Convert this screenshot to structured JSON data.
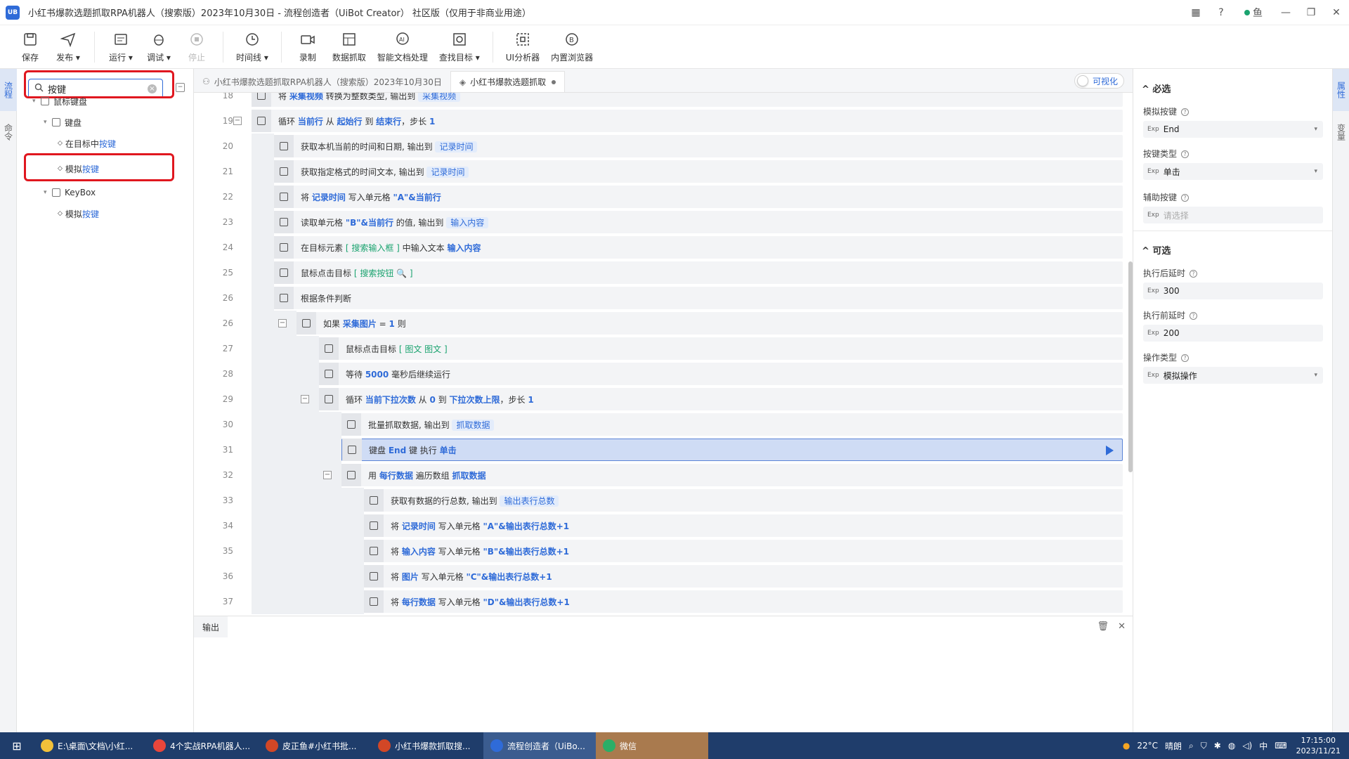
{
  "window": {
    "title": "小红书爆款选题抓取RPA机器人（搜索版）2023年10月30日 - 流程创造者（UiBot Creator） 社区版（仅用于非商业用途）",
    "logo_text": "UB",
    "user": "鱼"
  },
  "toolbar": {
    "save": "保存",
    "publish": "发布",
    "run": "运行",
    "debug": "调试",
    "stop": "停止",
    "timeline": "时间线",
    "record": "录制",
    "data_scrape": "数据抓取",
    "smart_doc": "智能文档处理",
    "find_target": "查找目标",
    "ui_analyzer": "UI分析器",
    "browser": "内置浏览器"
  },
  "left_rail": {
    "tab1": "流程",
    "tab2": "命令"
  },
  "left_panel": {
    "search_value": "按键",
    "tree": [
      {
        "label": "鼠标键盘"
      },
      {
        "label": "键盘"
      },
      {
        "prefix": "在目标中",
        "match": "按键"
      },
      {
        "prefix": "模拟",
        "match": "按键"
      },
      {
        "label": "KeyBox"
      },
      {
        "prefix": "模拟",
        "match": "按键"
      }
    ]
  },
  "tabs": [
    {
      "label": "小红书爆款选题抓取RPA机器人（搜索版）2023年10月30日"
    },
    {
      "label": "小红书爆款选题抓取"
    }
  ],
  "viz_toggle": "可视化",
  "editor_rows": [
    {
      "ln": "18",
      "parts": [
        {
          "t": "将 "
        },
        {
          "t": "采集视频",
          "c": "kw"
        },
        {
          "t": " 转换为整数类型, 输出到 "
        },
        {
          "t": "采集视频",
          "c": "var"
        }
      ]
    },
    {
      "ln": "19",
      "parts": [
        {
          "t": "循环 "
        },
        {
          "t": "当前行",
          "c": "kw"
        },
        {
          "t": " 从 "
        },
        {
          "t": "起始行",
          "c": "kw"
        },
        {
          "t": " 到 "
        },
        {
          "t": "结束行",
          "c": "kw"
        },
        {
          "t": "，步长 "
        },
        {
          "t": "1",
          "c": "kw"
        }
      ]
    },
    {
      "ln": "20",
      "parts": [
        {
          "t": "获取本机当前的时间和日期, 输出到 "
        },
        {
          "t": "记录时间",
          "c": "var"
        }
      ]
    },
    {
      "ln": "21",
      "parts": [
        {
          "t": "获取指定格式的时间文本, 输出到 "
        },
        {
          "t": "记录时间",
          "c": "var"
        }
      ]
    },
    {
      "ln": "22",
      "parts": [
        {
          "t": "将 "
        },
        {
          "t": "记录时间",
          "c": "kw"
        },
        {
          "t": " 写入单元格 "
        },
        {
          "t": "\"A\"&当前行",
          "c": "kw"
        }
      ]
    },
    {
      "ln": "23",
      "parts": [
        {
          "t": "读取单元格 "
        },
        {
          "t": "\"B\"&当前行",
          "c": "kw"
        },
        {
          "t": " 的值, 输出到 "
        },
        {
          "t": "输入内容",
          "c": "var"
        }
      ]
    },
    {
      "ln": "24",
      "parts": [
        {
          "t": "在目标元素 "
        },
        {
          "t": "[ 搜索输入框            ]",
          "c": "tgt"
        },
        {
          "t": " 中输入文本 "
        },
        {
          "t": "输入内容",
          "c": "kw"
        }
      ]
    },
    {
      "ln": "25",
      "parts": [
        {
          "t": "鼠标点击目标 "
        },
        {
          "t": "[ 搜索按钮  🔍  ]",
          "c": "tgt"
        }
      ]
    },
    {
      "ln": "26",
      "parts": [
        {
          "t": "根据条件判断"
        }
      ]
    },
    {
      "ln": "26",
      "parts": [
        {
          "t": "如果 "
        },
        {
          "t": "采集图片",
          "c": "kw"
        },
        {
          "t": " = "
        },
        {
          "t": "1",
          "c": "kw"
        },
        {
          "t": " 则"
        }
      ]
    },
    {
      "ln": "27",
      "parts": [
        {
          "t": "鼠标点击目标 "
        },
        {
          "t": "[ 图文   图文  ]",
          "c": "tgt"
        }
      ]
    },
    {
      "ln": "28",
      "parts": [
        {
          "t": "等待 "
        },
        {
          "t": "5000",
          "c": "kw"
        },
        {
          "t": " 毫秒后继续运行"
        }
      ]
    },
    {
      "ln": "29",
      "parts": [
        {
          "t": "循环 "
        },
        {
          "t": "当前下拉次数",
          "c": "kw"
        },
        {
          "t": " 从 "
        },
        {
          "t": "0",
          "c": "kw"
        },
        {
          "t": " 到 "
        },
        {
          "t": "下拉次数上限",
          "c": "kw"
        },
        {
          "t": "，步长 "
        },
        {
          "t": "1",
          "c": "kw"
        }
      ]
    },
    {
      "ln": "30",
      "parts": [
        {
          "t": "批量抓取数据, 输出到 "
        },
        {
          "t": "抓取数据",
          "c": "var"
        }
      ]
    },
    {
      "ln": "31",
      "parts": [
        {
          "t": "键盘 "
        },
        {
          "t": "End",
          "c": "kw"
        },
        {
          "t": " 键 执行 "
        },
        {
          "t": "单击",
          "c": "kw"
        }
      ]
    },
    {
      "ln": "32",
      "parts": [
        {
          "t": "用 "
        },
        {
          "t": "每行数据",
          "c": "kw"
        },
        {
          "t": " 遍历数组 "
        },
        {
          "t": "抓取数据",
          "c": "kw"
        }
      ]
    },
    {
      "ln": "33",
      "parts": [
        {
          "t": "获取有数据的行总数, 输出到 "
        },
        {
          "t": "输出表行总数",
          "c": "var"
        }
      ]
    },
    {
      "ln": "34",
      "parts": [
        {
          "t": "将 "
        },
        {
          "t": "记录时间",
          "c": "kw"
        },
        {
          "t": " 写入单元格 "
        },
        {
          "t": "\"A\"&输出表行总数+1",
          "c": "kw"
        }
      ]
    },
    {
      "ln": "35",
      "parts": [
        {
          "t": "将 "
        },
        {
          "t": "输入内容",
          "c": "kw"
        },
        {
          "t": " 写入单元格 "
        },
        {
          "t": "\"B\"&输出表行总数+1",
          "c": "kw"
        }
      ]
    },
    {
      "ln": "36",
      "parts": [
        {
          "t": "将 "
        },
        {
          "t": "图片",
          "c": "kw"
        },
        {
          "t": " 写入单元格 "
        },
        {
          "t": "\"C\"&输出表行总数+1",
          "c": "kw"
        }
      ]
    },
    {
      "ln": "37",
      "parts": [
        {
          "t": "将 "
        },
        {
          "t": "每行数据",
          "c": "kw"
        },
        {
          "t": " 写入单元格 "
        },
        {
          "t": "\"D\"&输出表行总数+1",
          "c": "kw"
        }
      ]
    }
  ],
  "output": {
    "tab": "输出"
  },
  "right_panel": {
    "required_title": "必选",
    "sim_key_label": "模拟按键",
    "sim_key_value": "End",
    "key_type_label": "按键类型",
    "key_type_value": "单击",
    "aux_key_label": "辅助按键",
    "aux_key_placeholder": "请选择",
    "optional_title": "可选",
    "delay_after_label": "执行后延时",
    "delay_after_value": "300",
    "delay_before_label": "执行前延时",
    "delay_before_value": "200",
    "op_type_label": "操作类型",
    "op_type_value": "模拟操作",
    "exp": "Exp"
  },
  "right_rail": {
    "tab1": "属性",
    "tab2": "变量"
  },
  "taskbar": {
    "items": [
      {
        "label": "E:\\桌面\\文档\\小红...",
        "color": "#f2c13a"
      },
      {
        "label": "4个实战RPA机器人...",
        "color": "#e9463b"
      },
      {
        "label": "皮正鱼#小红书批...",
        "color": "#d24726"
      },
      {
        "label": "小红书爆款抓取搜...",
        "color": "#d24726"
      },
      {
        "label": "流程创造者（UiBo...",
        "color": "#2f6bd8"
      },
      {
        "label": "微信",
        "color": "#2aae67"
      }
    ],
    "weather_temp": "22°C",
    "weather_text": "晴朗",
    "ime": "中",
    "time": "17:15:00",
    "date": "2023/11/21"
  }
}
